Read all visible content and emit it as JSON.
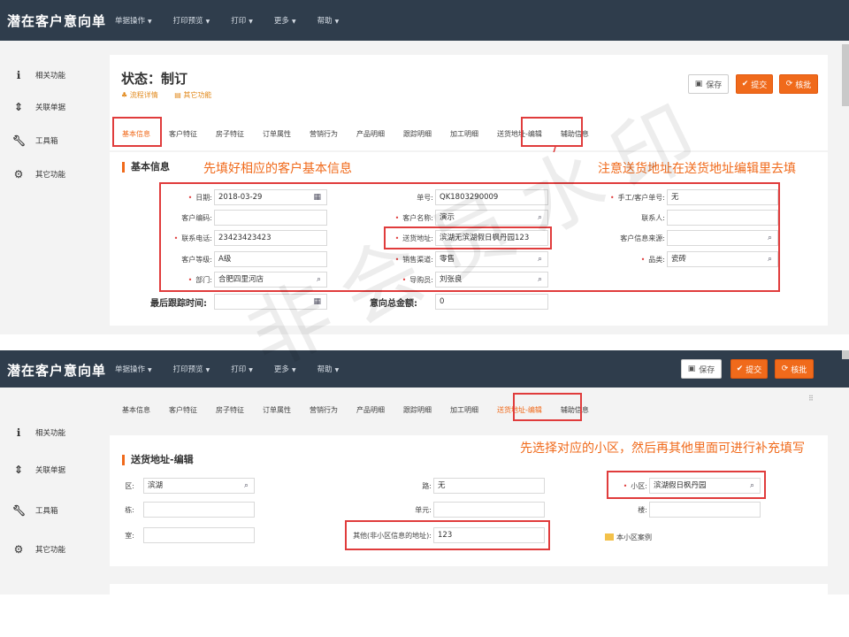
{
  "app": {
    "title": "潜在客户意向单"
  },
  "menu": [
    "单据操作",
    "打印预览",
    "打印",
    "更多",
    "帮助"
  ],
  "sidebar": [
    "相关功能",
    "关联单据",
    "工具箱",
    "其它功能"
  ],
  "status": {
    "title": "状态：制订",
    "links": [
      "流程详情",
      "其它功能"
    ]
  },
  "buttons": {
    "save": "保存",
    "submit": "提交",
    "review": "核批"
  },
  "tabs": [
    "基本信息",
    "客户特征",
    "房子特征",
    "订单属性",
    "营销行为",
    "产品明细",
    "跟踪明细",
    "加工明细",
    "送货地址-编辑",
    "辅助信息"
  ],
  "annotations": {
    "fill_basic": "先填好相应的客户基本信息",
    "address_note": "注意送货地址在送货地址编辑里去填",
    "select_community": "先选择对应的小区，然后再其他里面可进行补充填写"
  },
  "basic": {
    "section_title": "基本信息",
    "fields": {
      "date": {
        "label": "日期:",
        "value": "2018-03-29"
      },
      "customer_code": {
        "label": "客户编码:",
        "value": ""
      },
      "phone": {
        "label": "联系电话:",
        "value": "23423423423"
      },
      "customer_level": {
        "label": "客户等级:",
        "value": "A级"
      },
      "department": {
        "label": "部门:",
        "value": "合肥四里河店"
      },
      "order_no": {
        "label": "单号:",
        "value": "QK1803290009"
      },
      "customer_name": {
        "label": "客户名称:",
        "value": "演示"
      },
      "delivery_address": {
        "label": "送货地址:",
        "value": "滨湖无滨湖假日枫丹园123"
      },
      "sales_channel": {
        "label": "销售渠道:",
        "value": "零售"
      },
      "guide": {
        "label": "导购员:",
        "value": "刘张良"
      },
      "manual_no": {
        "label": "手工/客户单号:",
        "value": "无"
      },
      "contact": {
        "label": "联系人:",
        "value": ""
      },
      "info_source": {
        "label": "客户信息来源:",
        "value": ""
      },
      "category": {
        "label": "品类:",
        "value": "瓷砖"
      }
    },
    "last_follow": {
      "label": "最后跟踪时间:",
      "value": ""
    },
    "total_amount": {
      "label": "意向总金额:",
      "value": "0"
    }
  },
  "address": {
    "section_title": "送货地址-编辑",
    "district": {
      "label": "区:",
      "value": "滨湖"
    },
    "road": {
      "label": "路:",
      "value": "无"
    },
    "community": {
      "label": "小区:",
      "value": "滨湖假日枫丹园"
    },
    "building": {
      "label": "栋:",
      "value": ""
    },
    "unit": {
      "label": "单元:",
      "value": ""
    },
    "floor": {
      "label": "楼:",
      "value": ""
    },
    "room": {
      "label": "室:",
      "value": ""
    },
    "other": {
      "label": "其他(非小区信息的地址):",
      "value": "123"
    },
    "community_case": "本小区案例"
  },
  "watermark": "非会员水印"
}
